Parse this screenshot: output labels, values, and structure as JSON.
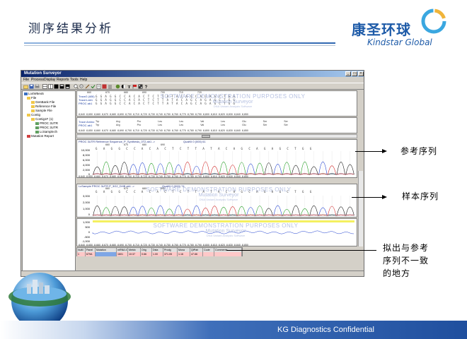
{
  "slide": {
    "title": "测序结果分析",
    "logo_cn": "康圣环球",
    "logo_en": "Kindstar Global",
    "footer": "KG Diagnostics Confidential"
  },
  "callouts": {
    "reference": "参考序列",
    "sample": "样本序列",
    "mismatch_line1": "拟出与参考",
    "mismatch_line2": "序列不一致",
    "mismatch_line3": "的地方"
  },
  "app": {
    "window_title": "Mutation Surveyor",
    "menu": [
      "File",
      "Process",
      "Display",
      "Reports",
      "Tools",
      "Help"
    ],
    "tree": [
      "Lo4W5eo5",
      "File",
      "GenBank File",
      "Reference File",
      "Sample File",
      "Contig",
      "Contig1F (1)",
      "PROC 3UTR",
      "PROC 3UTR",
      "LcSample.th",
      "Mutation Report"
    ],
    "top_panel": {
      "labels": [
        "Trace2 (ABI)",
        "Trace1.ab1",
        "PROC ab1"
      ],
      "seq1": "GGAGGCCACACTCTTATACAGCAGAGCTGG",
      "seq2": "GGAGGCCACACTCTTATACAGCAGAGCTGG",
      "seq3": "GGAGGCCACACTCTTATACAGCAGAGCTGG",
      "ruler_top": "660          670          680          690          700          710          720",
      "ruler_bottom": "8,640 8,650 8,660 8,670 8,680 8,690 8,700 8,710 8,720 8,730 8,740 8,750 8,760 8,770 8,780 8,790 8,800 8,810 8,820 8,830 8,840 8,850",
      "aa_labels": [
        "Trace Amino",
        "PROC ab1"
      ],
      "aa_row1": "Trp      Arg      Pro      Leu      Leu      Val      Leu      Glu      Ser      Ser",
      "aa_row2": "Trp      Arg      Pro      Leu      Leu      Val      Leu      Glu      Ser      Ser",
      "aa_ruler": "8,640 8,650 8,660 8,670 8,680 8,690 8,700 8,710 8,720 8,730 8,740 8,750 8,760 8,770 8,780 8,790 8,800 8,810 8,820 8,830 8,840 8,850"
    },
    "reference_track": {
      "title": "PROC 3UTR Reference Sequence_P_Synthesis_0T2.ab1 ->",
      "quality": "QualKt 0 (000) 61",
      "bases": "G A G G C C A C A C T C T T A T A C A G C A G A G C T G G",
      "ruler": "660          670          680          690",
      "ylabels": [
        "10,000",
        "8,000",
        "6,000",
        "4,000",
        "2,000",
        "0"
      ],
      "xaxis": "8,640 8,650 8,660 8,670 8,680 8,690 8,700 8,710 8,720 8,730 8,740 8,750 8,760 8,770 8,780 8,790 8,800 8,810 8,820 8,830 8,840 8,850"
    },
    "sample_track": {
      "title": "LcSample PROC 3UTR P_3G2_DHB ab1 ->",
      "quality": "QualKt 0 (000) 74",
      "bases": "G A G G C C A C A C T C T T A T A C A G C A G A G C T G G",
      "ruler": "660          670          680          690",
      "ylabels": [
        "3,000",
        "2,000",
        "1,000",
        "0"
      ],
      "xaxis": "8,640 8,650 8,660 8,670 8,680 8,690 8,700 8,710 8,720 8,730 8,740 8,750 8,760 8,770 8,780 8,790 8,800 8,810 8,820 8,830 8,840 8,850"
    },
    "diff_track": {
      "ylabels": [
        "1,000",
        "500",
        "0",
        "-500",
        "-1,000"
      ],
      "xaxis": "8,640 8,650 8,660 8,670 8,680 8,690 8,700 8,710 8,720 8,730 8,740 8,750 8,760 8,770 8,780 8,790 8,800 8,810 8,820 8,830 8,840 8,850"
    },
    "watermark": {
      "line1": "SOFTWARE DEMONSTRATION PURPOSES ONLY",
      "line2": "Mutation Surveyor",
      "line3": "DNA Variant Analysis Software"
    },
    "mutation_table": {
      "headers": [
        "NuM",
        "Panel",
        "Mutation",
        "mRNA 4",
        "Metdx",
        "Orig",
        "Dsta",
        "Prodg",
        "Mona",
        "QtPah",
        "Code",
        "Comments"
      ],
      "row": [
        "1",
        "679A",
        "",
        "1601",
        "10:37",
        "0.66",
        "1.00",
        "371.05",
        "1.16",
        "47.66",
        "",
        ""
      ]
    }
  }
}
